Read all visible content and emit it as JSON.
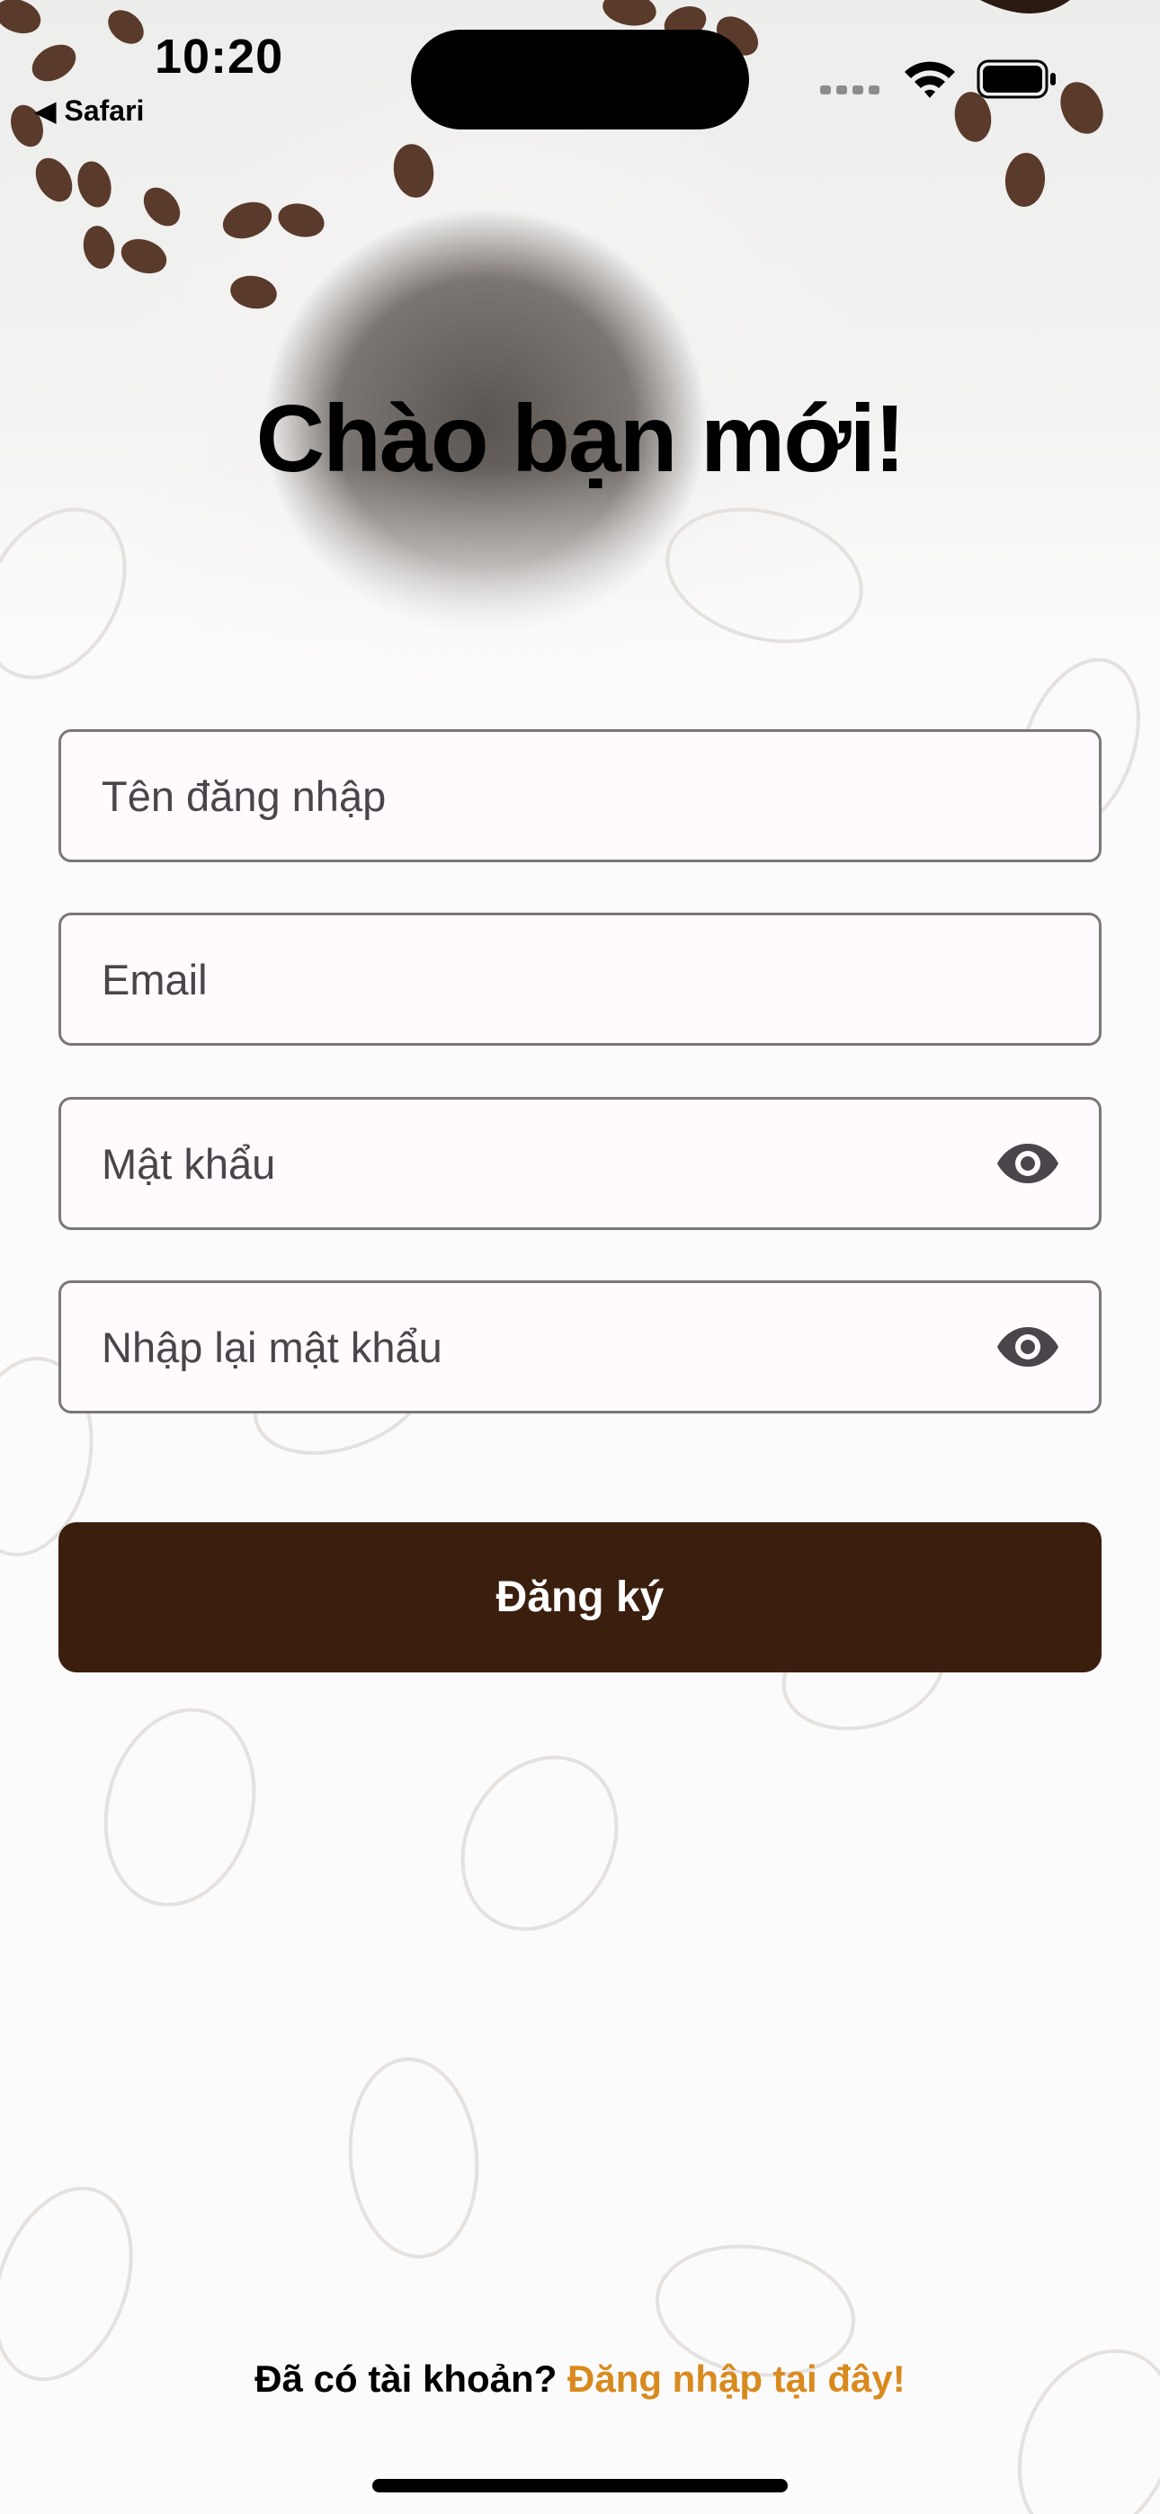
{
  "status_bar": {
    "time": "10:20",
    "back_label": "◀ Safari"
  },
  "title": "Chào bạn mới!",
  "form": {
    "username_placeholder": "Tên đăng nhập",
    "email_placeholder": "Email",
    "password_placeholder": "Mật khẩu",
    "confirm_password_placeholder": "Nhập lại mật khẩu",
    "submit_label": "Đăng ký"
  },
  "footer": {
    "prompt": "Đã có tài khoản? ",
    "login_link": "Đăng nhập tại đây!"
  },
  "colors": {
    "primary_button": "#3b1f0e",
    "link_accent": "#d98a1e",
    "field_background": "#fffafd",
    "field_border": "#7a7679"
  },
  "icons": {
    "password_toggle": "eye-icon",
    "status": [
      "signal-icon",
      "wifi-icon",
      "battery-icon"
    ]
  }
}
